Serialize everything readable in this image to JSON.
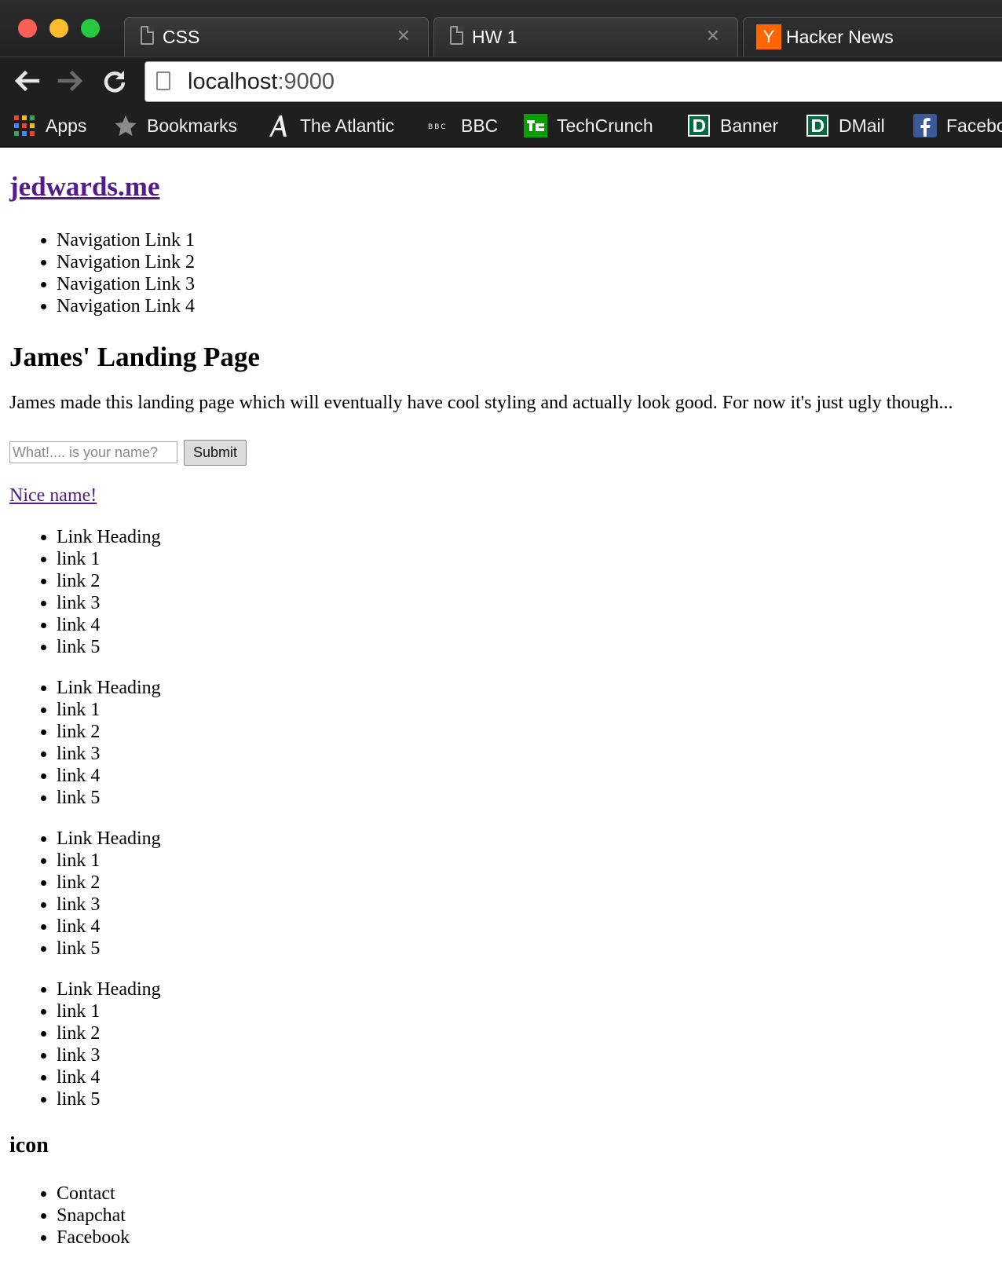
{
  "browser": {
    "tabs": [
      {
        "label": "CSS",
        "icon": "document-icon"
      },
      {
        "label": "HW 1",
        "icon": "document-icon"
      },
      {
        "label": "Hacker News",
        "icon": "hacker-news-icon",
        "icon_letter": "Y"
      }
    ],
    "tab_close_glyph": "✕",
    "address": {
      "host": "localhost",
      "port": ":9000"
    },
    "bookmarks": [
      {
        "label": "Apps",
        "icon": "apps-grid-icon"
      },
      {
        "label": "Bookmarks",
        "icon": "star-icon"
      },
      {
        "label": "The Atlantic",
        "icon": "atlantic-icon"
      },
      {
        "label": "BBC",
        "icon": "bbc-icon"
      },
      {
        "label": "TechCrunch",
        "icon": "techcrunch-icon"
      },
      {
        "label": "Banner",
        "icon": "dartmouth-icon"
      },
      {
        "label": "DMail",
        "icon": "dartmouth-icon"
      },
      {
        "label": "Facebo",
        "icon": "facebook-icon"
      }
    ],
    "colors": {
      "hn_orange": "#ff6600",
      "techcrunch_green": "#0a9e01",
      "facebook_blue": "#3b5998",
      "dartmouth_green": "#00693e"
    }
  },
  "page": {
    "site_title": "jedwards.me",
    "nav_links": [
      "Navigation Link 1",
      "Navigation Link 2",
      "Navigation Link 3",
      "Navigation Link 4"
    ],
    "heading": "James' Landing Page",
    "intro": "James made this landing page which will eventually have cool styling and actually look good. For now it's just ugly though...",
    "form": {
      "placeholder": "What!.... is your name?",
      "submit_label": "Submit"
    },
    "nice_name": "Nice name!",
    "link_groups": [
      {
        "heading": "Link Heading",
        "links": [
          "link 1",
          "link 2",
          "link 3",
          "link 4",
          "link 5"
        ]
      },
      {
        "heading": "Link Heading",
        "links": [
          "link 1",
          "link 2",
          "link 3",
          "link 4",
          "link 5"
        ]
      },
      {
        "heading": "Link Heading",
        "links": [
          "link 1",
          "link 2",
          "link 3",
          "link 4",
          "link 5"
        ]
      },
      {
        "heading": "Link Heading",
        "links": [
          "link 1",
          "link 2",
          "link 3",
          "link 4",
          "link 5"
        ]
      }
    ],
    "icon_heading": "icon",
    "footer_links": [
      "Contact",
      "Snapchat",
      "Facebook"
    ],
    "link_color": "#551a8b"
  }
}
